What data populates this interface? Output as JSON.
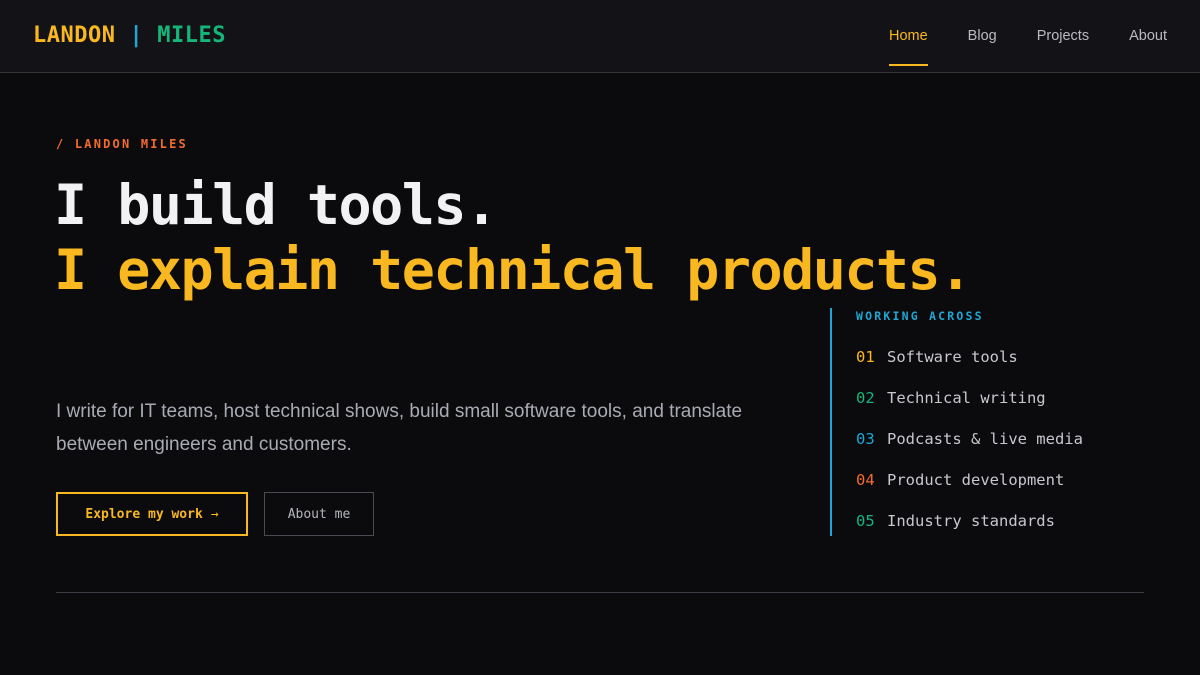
{
  "header": {
    "logo": {
      "first": "LANDON",
      "separator": "|",
      "second": "MILES"
    },
    "nav": [
      {
        "label": "Home",
        "active": true
      },
      {
        "label": "Blog",
        "active": false
      },
      {
        "label": "Projects",
        "active": false
      },
      {
        "label": "About",
        "active": false
      }
    ]
  },
  "hero": {
    "eyebrow": "/ LANDON MILES",
    "headline_line1": "I build tools.",
    "headline_line2": "I explain technical products.",
    "intro": "I write for IT teams, host technical shows, build small software tools, and translate between engineers and customers.",
    "primary_button": {
      "label": "Explore my work",
      "arrow": "→"
    },
    "secondary_button": {
      "label": "About me"
    }
  },
  "working_across": {
    "title": "WORKING ACROSS",
    "items": [
      {
        "num": "01",
        "label": "Software tools",
        "color": "#f9b820"
      },
      {
        "num": "02",
        "label": "Technical writing",
        "color": "#16b57a"
      },
      {
        "num": "03",
        "label": "Podcasts & live media",
        "color": "#1ea7d4"
      },
      {
        "num": "04",
        "label": "Product development",
        "color": "#f26b2e"
      },
      {
        "num": "05",
        "label": "Industry standards",
        "color": "#16b57a"
      }
    ]
  },
  "colors": {
    "accent": "#f9b820",
    "green": "#16b57a",
    "blue": "#1ea7d4",
    "orange": "#f26b2e",
    "background": "#0b0b0e"
  }
}
